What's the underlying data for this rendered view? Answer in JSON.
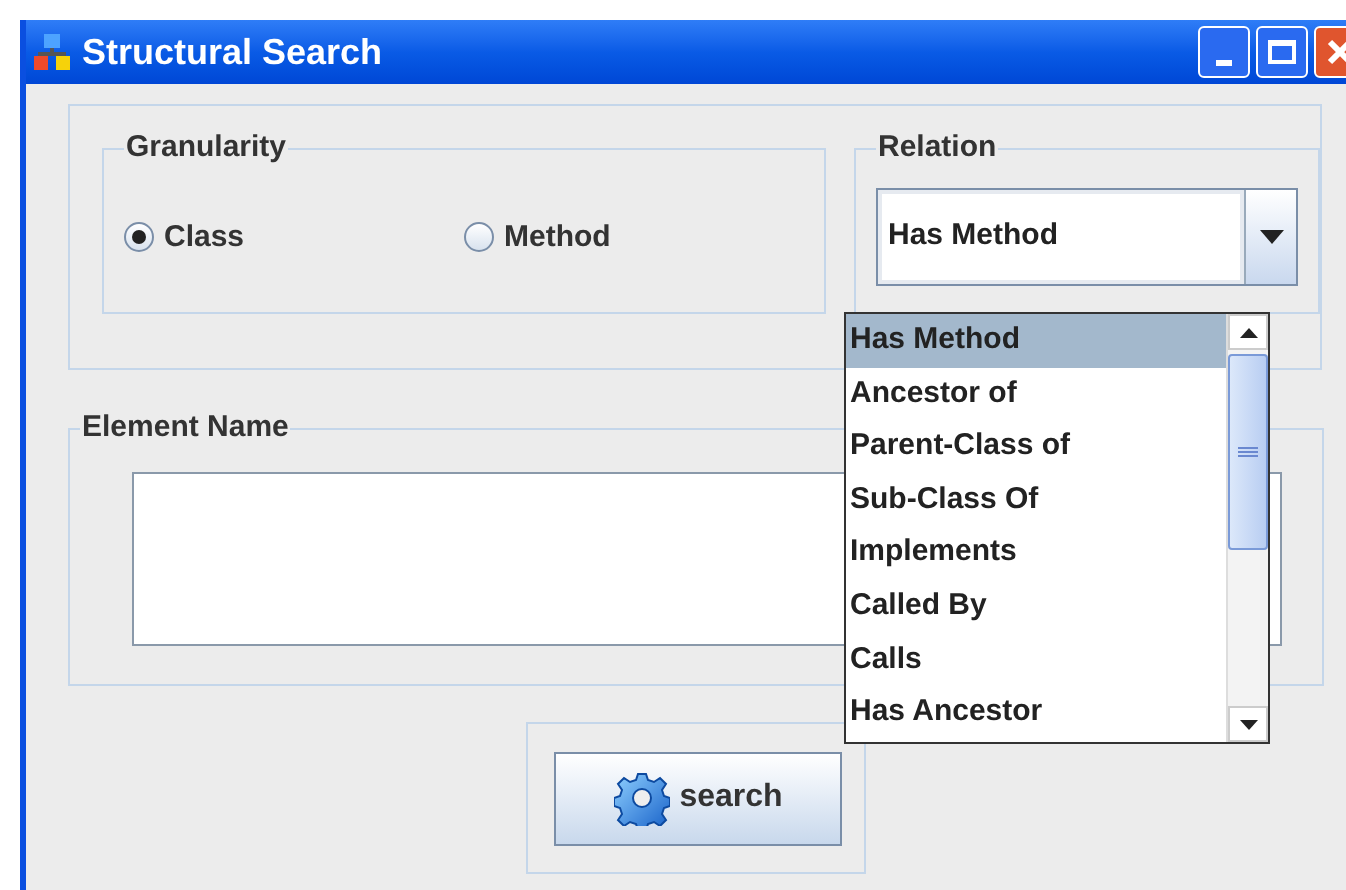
{
  "window": {
    "title": "Structural Search"
  },
  "granularity": {
    "legend": "Granularity",
    "options": [
      {
        "label": "Class",
        "selected": true
      },
      {
        "label": "Method",
        "selected": false
      }
    ]
  },
  "relation": {
    "legend": "Relation",
    "value": "Has Method",
    "expanded": true,
    "options": [
      {
        "label": "Has Method",
        "selected": true
      },
      {
        "label": "Ancestor of",
        "selected": false
      },
      {
        "label": "Parent-Class of",
        "selected": false
      },
      {
        "label": "Sub-Class Of",
        "selected": false
      },
      {
        "label": "Implements",
        "selected": false
      },
      {
        "label": "Called By",
        "selected": false
      },
      {
        "label": "Calls",
        "selected": false
      },
      {
        "label": "Has Ancestor",
        "selected": false
      }
    ]
  },
  "element_name": {
    "legend": "Element Name"
  },
  "search_button": {
    "label": "search"
  }
}
